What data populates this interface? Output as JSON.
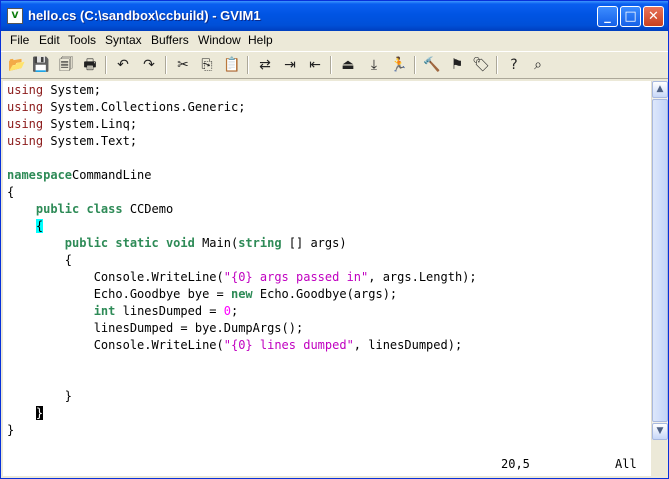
{
  "window": {
    "title": "hello.cs (C:\\sandbox\\ccbuild) - GVIM1",
    "icon": "vim-icon"
  },
  "titlebar_buttons": [
    {
      "name": "minimize-button",
      "glyph": "_"
    },
    {
      "name": "maximize-button",
      "glyph": "□"
    },
    {
      "name": "close-button",
      "glyph": "✕"
    }
  ],
  "menu": [
    "File",
    "Edit",
    "Tools",
    "Syntax",
    "Buffers",
    "Window",
    "Help"
  ],
  "toolbar": [
    {
      "name": "open-icon",
      "glyph": "📂"
    },
    {
      "name": "save-icon",
      "glyph": "💾"
    },
    {
      "name": "save-all-icon",
      "glyph": "🗐"
    },
    {
      "name": "print-icon",
      "glyph": "🖶"
    },
    {
      "name": "undo-icon",
      "glyph": "↶"
    },
    {
      "name": "redo-icon",
      "glyph": "↷"
    },
    {
      "name": "cut-icon",
      "glyph": "✂"
    },
    {
      "name": "copy-icon",
      "glyph": "⎘"
    },
    {
      "name": "paste-icon",
      "glyph": "📋"
    },
    {
      "name": "replace-icon",
      "glyph": "⇄"
    },
    {
      "name": "find-next-icon",
      "glyph": "⇥"
    },
    {
      "name": "find-prev-icon",
      "glyph": "⇤"
    },
    {
      "name": "load-session-icon",
      "glyph": "⏏"
    },
    {
      "name": "save-session-icon",
      "glyph": "⤓"
    },
    {
      "name": "run-script-icon",
      "glyph": "🏃"
    },
    {
      "name": "make-icon",
      "glyph": "🔨"
    },
    {
      "name": "build-tags-icon",
      "glyph": "⚑"
    },
    {
      "name": "jump-tag-icon",
      "glyph": "🏷"
    },
    {
      "name": "help-icon",
      "glyph": "?"
    },
    {
      "name": "find-help-icon",
      "glyph": "⌕"
    }
  ],
  "code_lines": [
    [
      [
        "kw",
        "using"
      ],
      [
        "",
        "System;"
      ]
    ],
    [
      [
        "kw",
        "using"
      ],
      [
        "",
        "System.Collections.Generic;"
      ]
    ],
    [
      [
        "kw",
        "using"
      ],
      [
        "",
        "System.Linq;"
      ]
    ],
    [
      [
        "kw",
        "using"
      ],
      [
        "",
        "System.Text;"
      ]
    ],
    [],
    [
      [
        "kw2",
        "namespace"
      ],
      [
        "",
        "CommandLine"
      ]
    ],
    [
      [
        "",
        "{"
      ]
    ],
    [
      [
        "",
        "    "
      ],
      [
        "kw2",
        "public class"
      ],
      [
        "",
        " CCDemo"
      ]
    ],
    [
      [
        "",
        "    "
      ],
      [
        "brace-hl",
        "{"
      ]
    ],
    [
      [
        "",
        "        "
      ],
      [
        "kw2",
        "public static void"
      ],
      [
        "",
        " Main("
      ],
      [
        "kw2",
        "string"
      ],
      [
        "",
        " [] args)"
      ]
    ],
    [
      [
        "",
        "        {"
      ]
    ],
    [
      [
        "",
        "            Console.WriteLine("
      ],
      [
        "str",
        "\"{0} args passed in\""
      ],
      [
        "",
        ", args.Length);"
      ]
    ],
    [
      [
        "",
        "            Echo.Goodbye bye = "
      ],
      [
        "kw2",
        "new"
      ],
      [
        "",
        " Echo.Goodbye(args);"
      ]
    ],
    [
      [
        "",
        "            "
      ],
      [
        "kw2",
        "int"
      ],
      [
        "",
        " linesDumped = "
      ],
      [
        "num",
        "0"
      ],
      [
        "",
        ";"
      ]
    ],
    [
      [
        "",
        "            linesDumped = bye.DumpArgs();"
      ]
    ],
    [
      [
        "",
        "            Console.WriteLine("
      ],
      [
        "str",
        "\"{0} lines dumped\""
      ],
      [
        "",
        ", linesDumped);"
      ]
    ],
    [],
    [],
    [
      [
        "",
        "        }"
      ]
    ],
    [
      [
        "",
        "    "
      ],
      [
        "cursor",
        "}"
      ]
    ],
    [
      [
        "",
        "}"
      ]
    ]
  ],
  "status": {
    "position": "20,5",
    "scroll": "All"
  },
  "colors": {
    "title_gradient_top": "#3d95ff",
    "keyword": "#8b1a1a",
    "type_keyword": "#2e8b57",
    "string": "#c000c0",
    "number": "#ff00ff",
    "brace_highlight": "#00ffff"
  }
}
